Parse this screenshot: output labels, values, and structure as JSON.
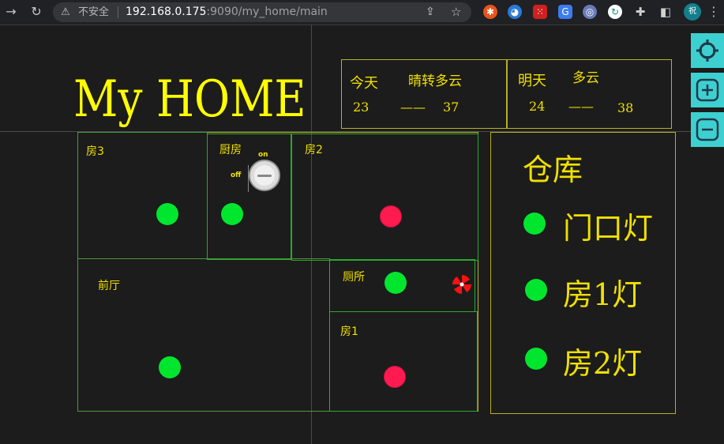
{
  "browser": {
    "security_text": "不安全",
    "url_host": "192.168.0.175",
    "url_rest": ":9090/my_home/main",
    "profile_initial": "祝"
  },
  "page": {
    "title": "My HOME"
  },
  "weather": {
    "today": {
      "day": "今天",
      "condition": "晴转多云",
      "low": "23",
      "dash": "——",
      "high": "37"
    },
    "tomorrow": {
      "day": "明天",
      "condition": "多云",
      "low": "24",
      "dash": "——",
      "high": "38"
    }
  },
  "rooms": {
    "room3": {
      "label": "房3",
      "light": "on"
    },
    "kitchen": {
      "label": "厨房",
      "light": "on",
      "switch_on": "on",
      "switch_off": "off"
    },
    "room2": {
      "label": "房2",
      "light": "off"
    },
    "living": {
      "label": "前厅",
      "light": "on"
    },
    "toilet": {
      "label": "厕所",
      "light": "on"
    },
    "room1": {
      "label": "房1",
      "light": "off"
    }
  },
  "warehouse": {
    "title": "仓库",
    "lights": [
      {
        "label": "门口灯",
        "state": "on"
      },
      {
        "label": "房1灯",
        "state": "on"
      },
      {
        "label": "房2灯",
        "state": "on"
      }
    ]
  },
  "colors": {
    "light_on": "#00e62e",
    "light_off": "#ff1a50",
    "text": "#f0e000",
    "room_border": "#2ea82e",
    "zoom_button": "#3ed0d0"
  }
}
